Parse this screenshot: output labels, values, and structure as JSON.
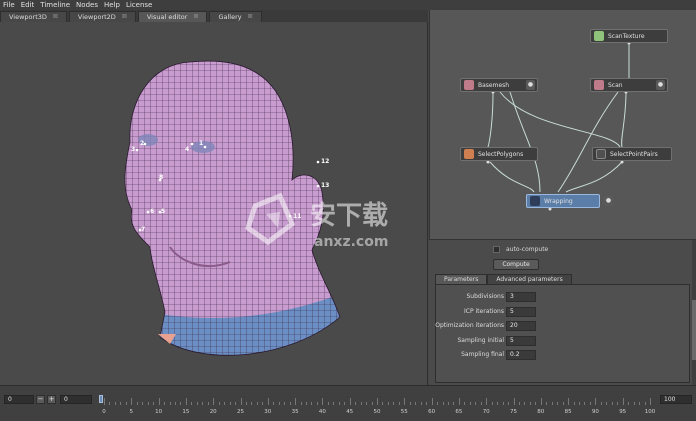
{
  "menu": [
    "File",
    "Edit",
    "Timeline",
    "Nodes",
    "Help",
    "License"
  ],
  "tabs": [
    {
      "label": "Viewport3D",
      "close": "⊠"
    },
    {
      "label": "Viewport2D",
      "close": "⊠"
    },
    {
      "label": "Visual editor",
      "close": "⊠"
    },
    {
      "label": "Gallery",
      "close": "⊠"
    }
  ],
  "landmarks": [
    "2",
    "3",
    "4",
    "1",
    "12",
    "13",
    "8",
    "11",
    "6",
    "5",
    "7"
  ],
  "nodes": {
    "scantexture": "ScanTexture",
    "basemesh": "Basemesh",
    "scan": "Scan",
    "selectpolygons": "SelectPolygons",
    "selectpointpairs": "SelectPointPairs",
    "wrapping": "Wrapping"
  },
  "props": {
    "auto_compute": "auto-compute",
    "compute_button": "Compute",
    "tabs": [
      "Parameters",
      "Advanced parameters"
    ],
    "rows": [
      {
        "label": "Subdivisions",
        "value": "3"
      },
      {
        "label": "ICP iterations",
        "value": "5"
      },
      {
        "label": "Optimization iterations",
        "value": "20"
      },
      {
        "label": "Sampling initial",
        "value": "5"
      },
      {
        "label": "Sampling final",
        "value": "0.2"
      }
    ]
  },
  "timeline": {
    "start": "0",
    "minus": "−",
    "plus": "+",
    "current": "0",
    "end": "100",
    "ticks": [
      "0",
      "5",
      "10",
      "15",
      "20",
      "25",
      "30",
      "35",
      "40",
      "45",
      "50",
      "55",
      "60",
      "65",
      "70",
      "75",
      "80",
      "85",
      "90",
      "95",
      "100"
    ]
  },
  "watermark": {
    "cn": "安下载",
    "en": "anxz.com"
  },
  "colors": {
    "mesh": "#c89ccf",
    "mesh_line": "#3a2440",
    "mesh_blue": "#6b8fc4",
    "node_selected": "#5b7ea8"
  }
}
